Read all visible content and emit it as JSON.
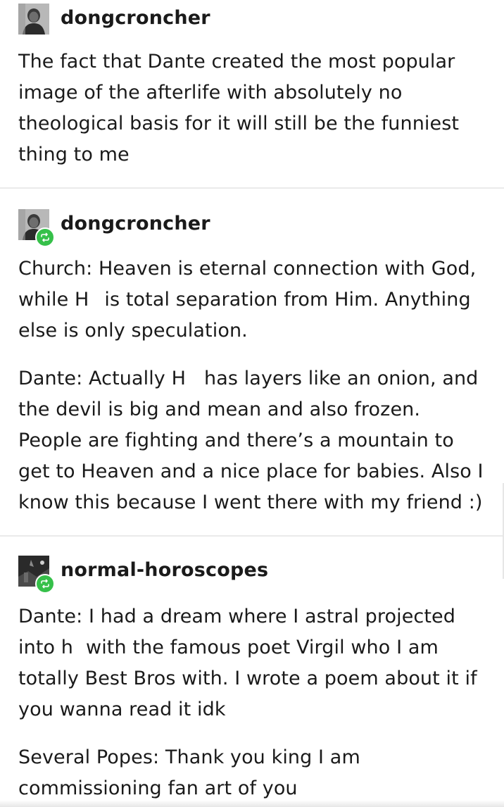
{
  "colors": {
    "reblog_badge": "#36c04a",
    "divider": "#eaeaea",
    "text": "#1a1a1a"
  },
  "posts": [
    {
      "username": "dongcroncher",
      "avatar_icon": "avatar-portrait-icon",
      "reblogged": false,
      "paragraphs": [
        "The fact that Dante created the most popular image of the afterlife with absolutely no theological basis for it will still be the funniest thing to me"
      ]
    },
    {
      "username": "dongcroncher",
      "avatar_icon": "avatar-portrait-icon",
      "reblogged": true,
      "paragraphs": [
        {
          "before": "Church: Heaven is eternal connection with God, while H",
          "after": "is total separation from Him. Anything else is only speculation."
        },
        {
          "before": "Dante: Actually H",
          "after": "has layers like an onion, and the devil is big and mean and also frozen. People are fighting and there’s a mountain to get to Heaven and a nice place for babies. Also I know this because I went there with my friend :)"
        }
      ]
    },
    {
      "username": "normal-horoscopes",
      "avatar_icon": "avatar-dark-photo-icon",
      "reblogged": true,
      "paragraphs": [
        {
          "before": "Dante: I had a dream where I astral projected into h",
          "after": "with the famous poet Virgil who I am totally Best Bros with. I wrote a poem about it if you wanna read it idk"
        },
        "Several Popes: Thank you king I am commissioning fan art of you"
      ]
    }
  ]
}
